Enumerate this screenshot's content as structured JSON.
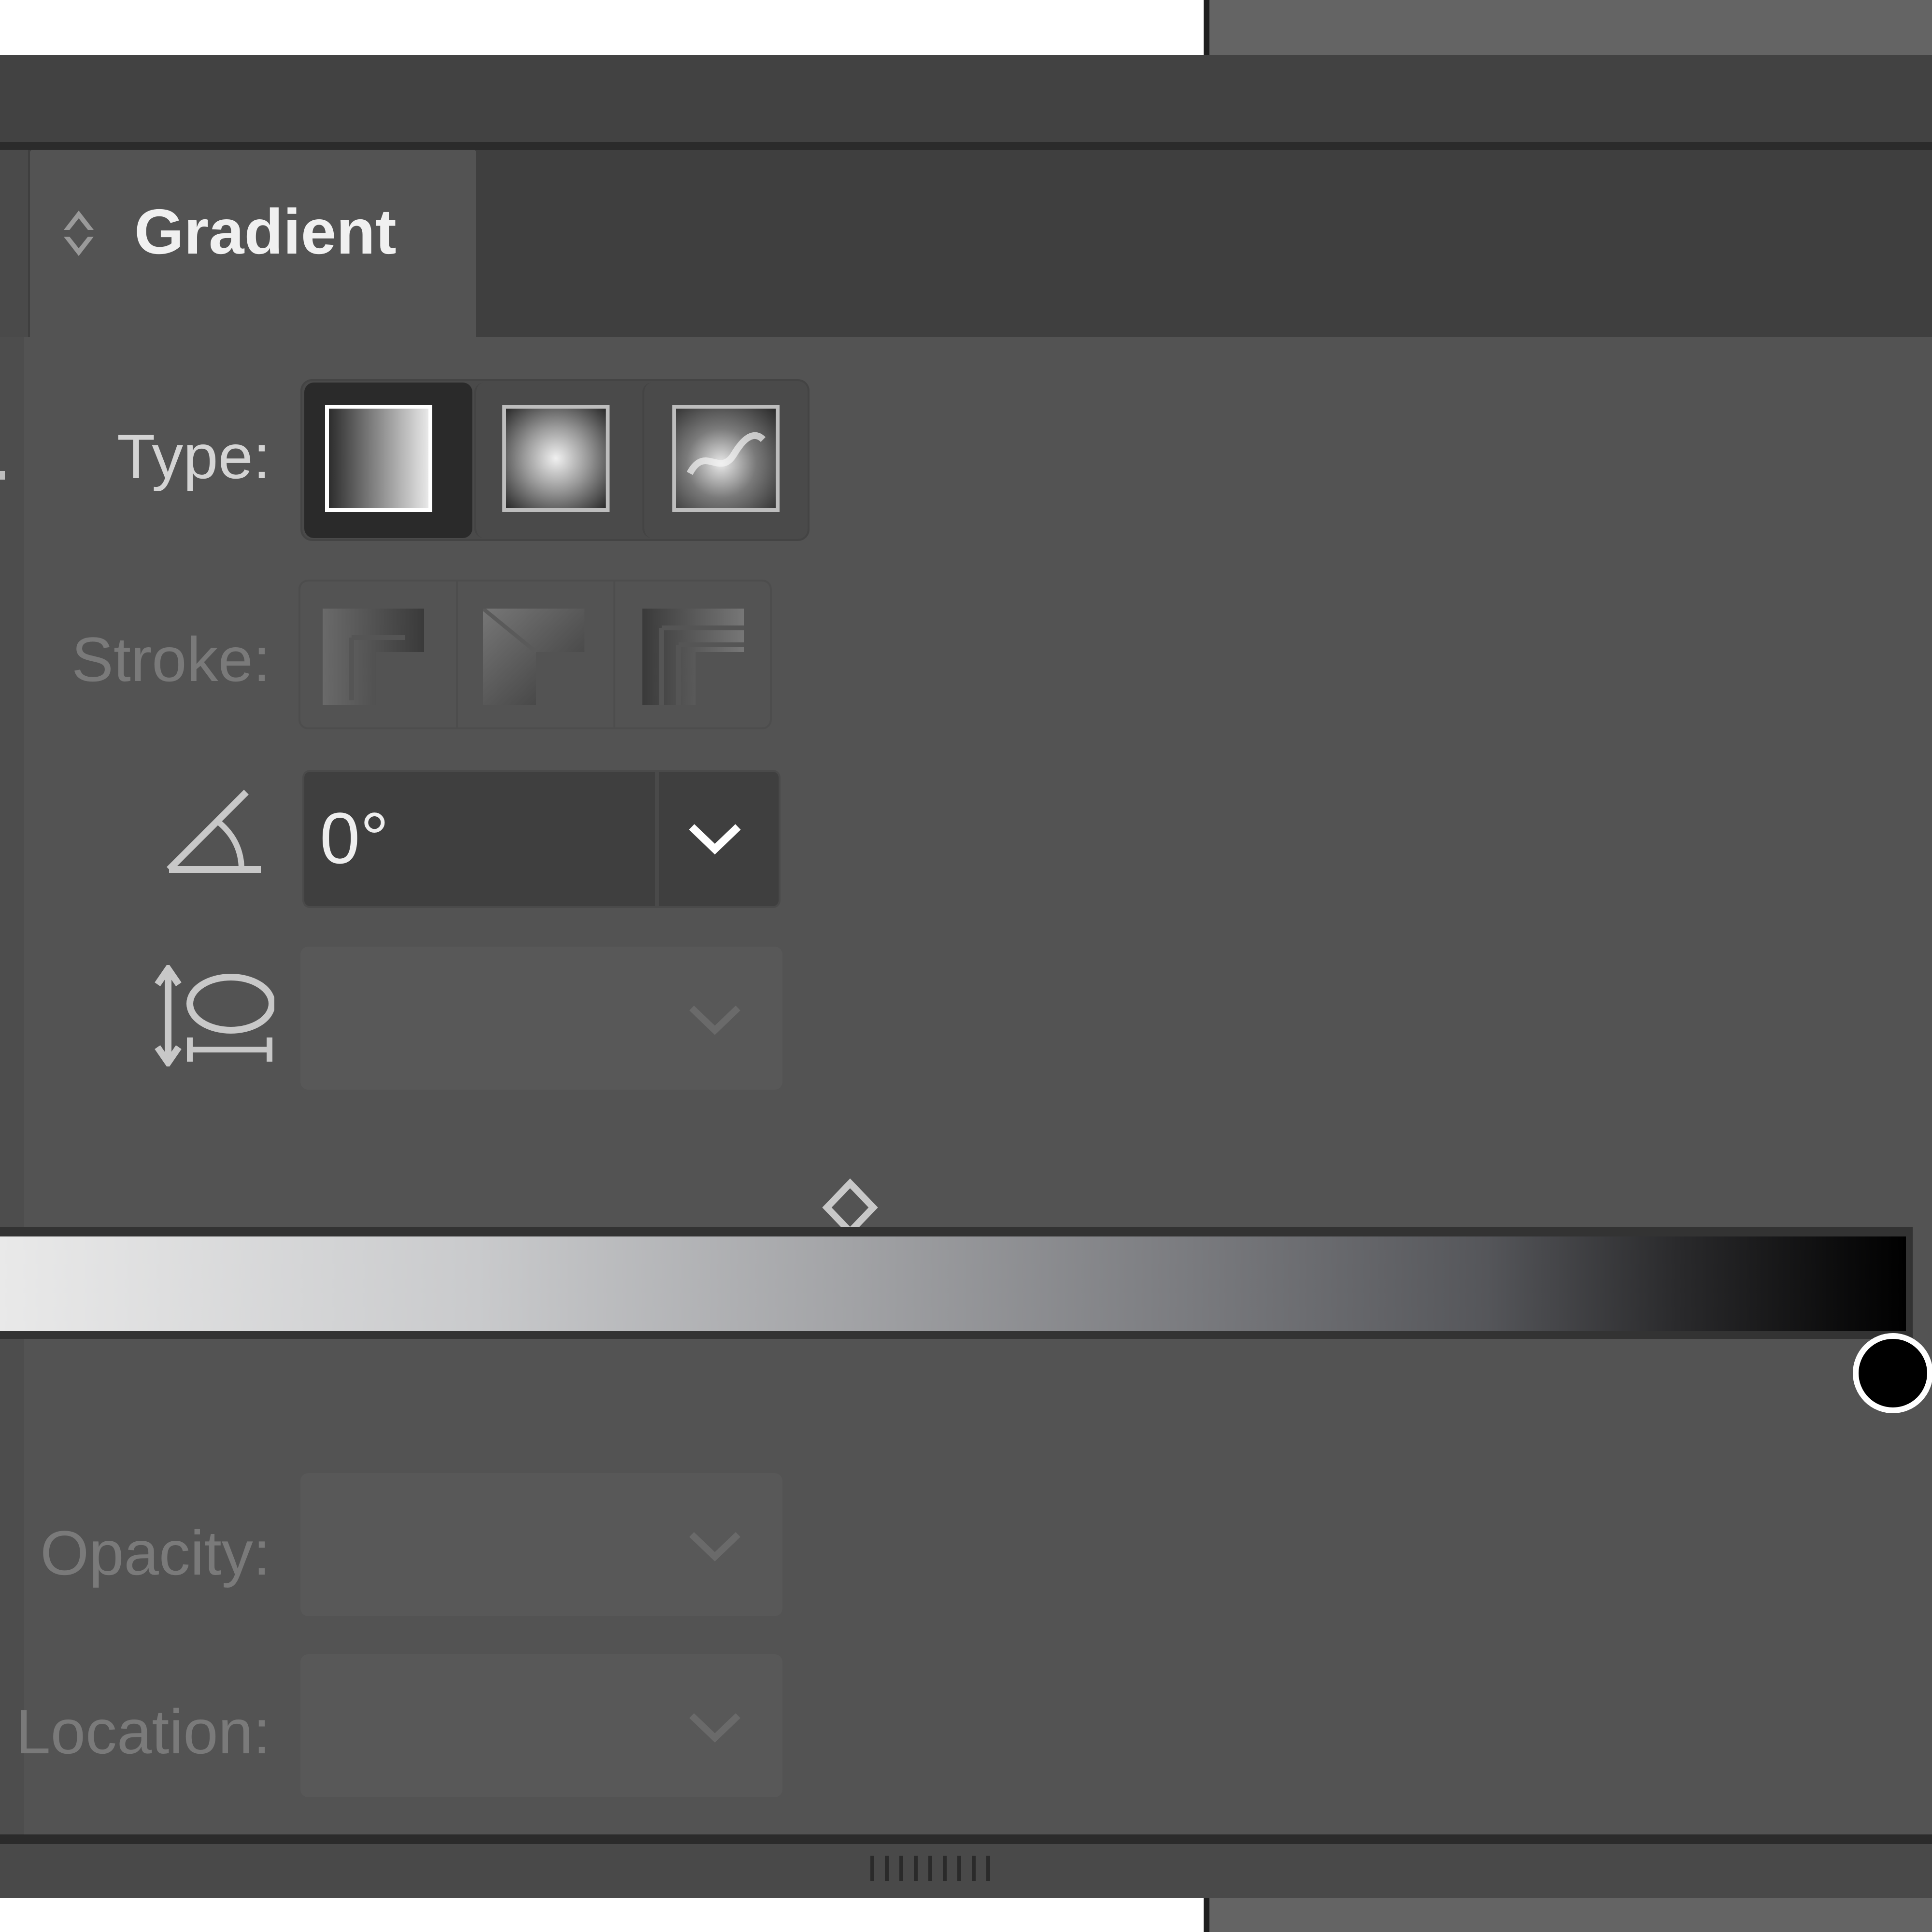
{
  "panel": {
    "tab_label": "Gradient"
  },
  "type_row": {
    "label": "Type:",
    "options": [
      "linear-gradient-icon",
      "radial-gradient-icon",
      "freeform-gradient-icon"
    ],
    "selected": "linear-gradient-icon"
  },
  "stroke_row": {
    "label": "Stroke:",
    "options": [
      "stroke-within-icon",
      "stroke-along-icon",
      "stroke-across-icon"
    ],
    "enabled": false
  },
  "angle": {
    "icon": "angle-icon",
    "value": "0°"
  },
  "aspect_ratio": {
    "icon": "aspect-ratio-icon",
    "value": "",
    "enabled": false
  },
  "gradient_slider": {
    "start_color": "#e9e9e9",
    "end_color": "#000000",
    "midpoint": 0.44
  },
  "opacity": {
    "label": "Opacity:",
    "value": "",
    "enabled": false
  },
  "location": {
    "label": "Location:",
    "value": "",
    "enabled": false
  },
  "colors": {
    "panel_bg": "#535353",
    "tab_strip": "#3f3f3f",
    "field_bg": "#3f3f3f",
    "text": "#eeeeee",
    "disabled_text": "#7a7a7a"
  }
}
